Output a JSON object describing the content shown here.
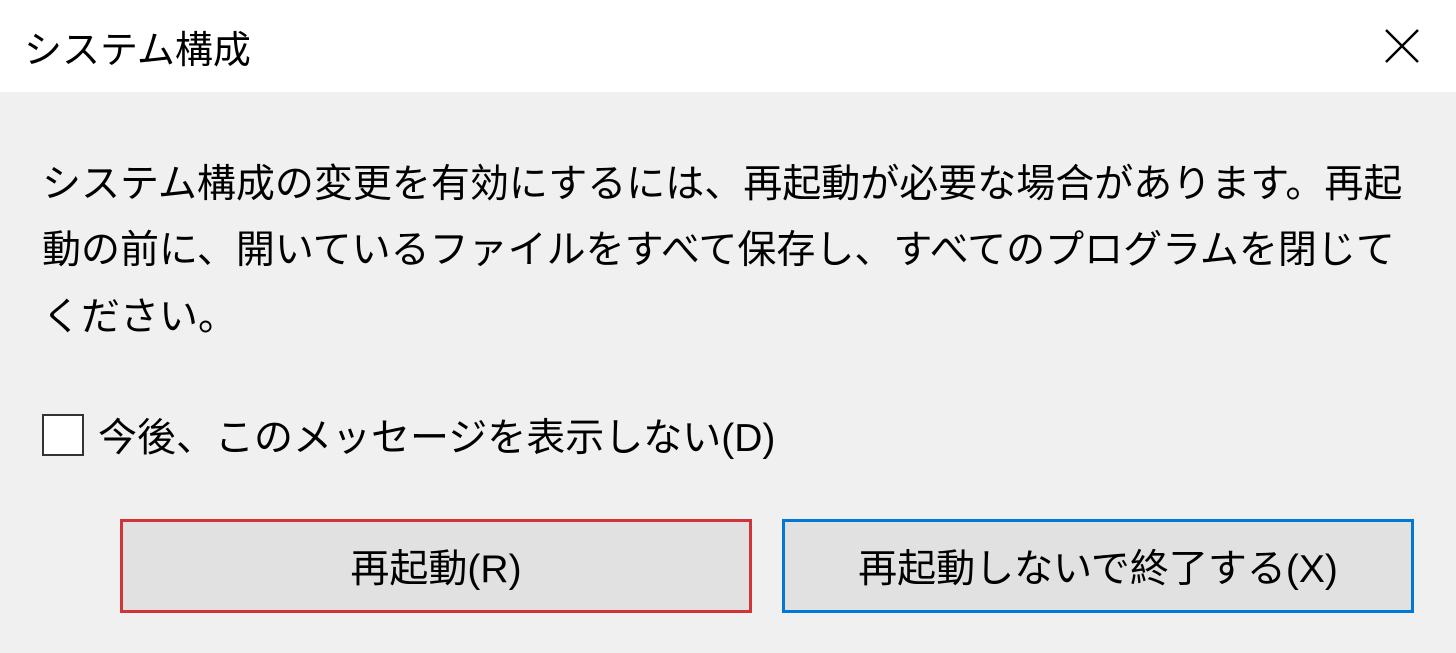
{
  "title": "システム構成",
  "message": "システム構成の変更を有効にするには、再起動が必要な場合があります。再起動の前に、開いているファイルをすべて保存し、すべてのプログラムを閉じてください。",
  "checkbox": {
    "label": "今後、このメッセージを表示しない(D)",
    "checked": false
  },
  "buttons": {
    "restart": "再起動(R)",
    "exit": "再起動しないで終了する(X)"
  }
}
